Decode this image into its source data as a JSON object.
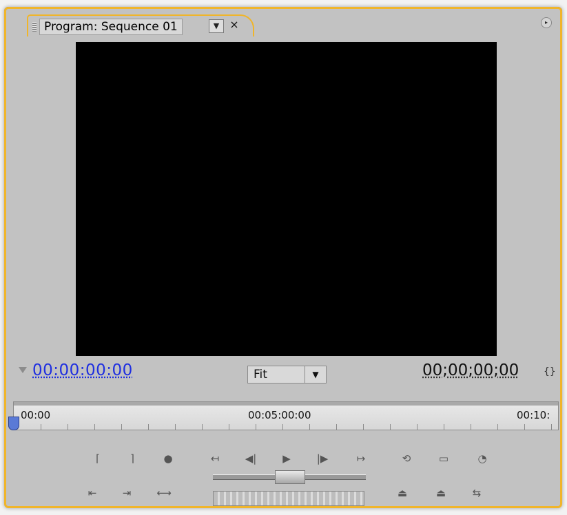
{
  "tab": {
    "title": "Program: Sequence 01",
    "menu_glyph": "▼",
    "close_glyph": "×"
  },
  "panel_menu_glyph": "▸",
  "timecode": {
    "current": "00:00:00:00",
    "duration": "00;00;00;00"
  },
  "zoom": {
    "value": "Fit",
    "arrow": "▼"
  },
  "ruler": {
    "labels": [
      "00:00",
      "00:05:00:00",
      "00:10:"
    ]
  },
  "controls": {
    "row1": [
      "mark-in",
      "mark-out",
      "set-marker",
      "go-to-in",
      "step-back",
      "play",
      "step-forward",
      "go-to-out",
      "loop",
      "safe-margins",
      "output"
    ],
    "row2": [
      "go-to-previous-edit",
      "go-to-next-edit",
      "play-in-to-out",
      "shuttle",
      "jog",
      "lift",
      "extract",
      "trim"
    ]
  },
  "colors": {
    "panel_border": "#f0b52a",
    "timecode_current": "#1f2fe0",
    "video_bg": "#000000"
  }
}
